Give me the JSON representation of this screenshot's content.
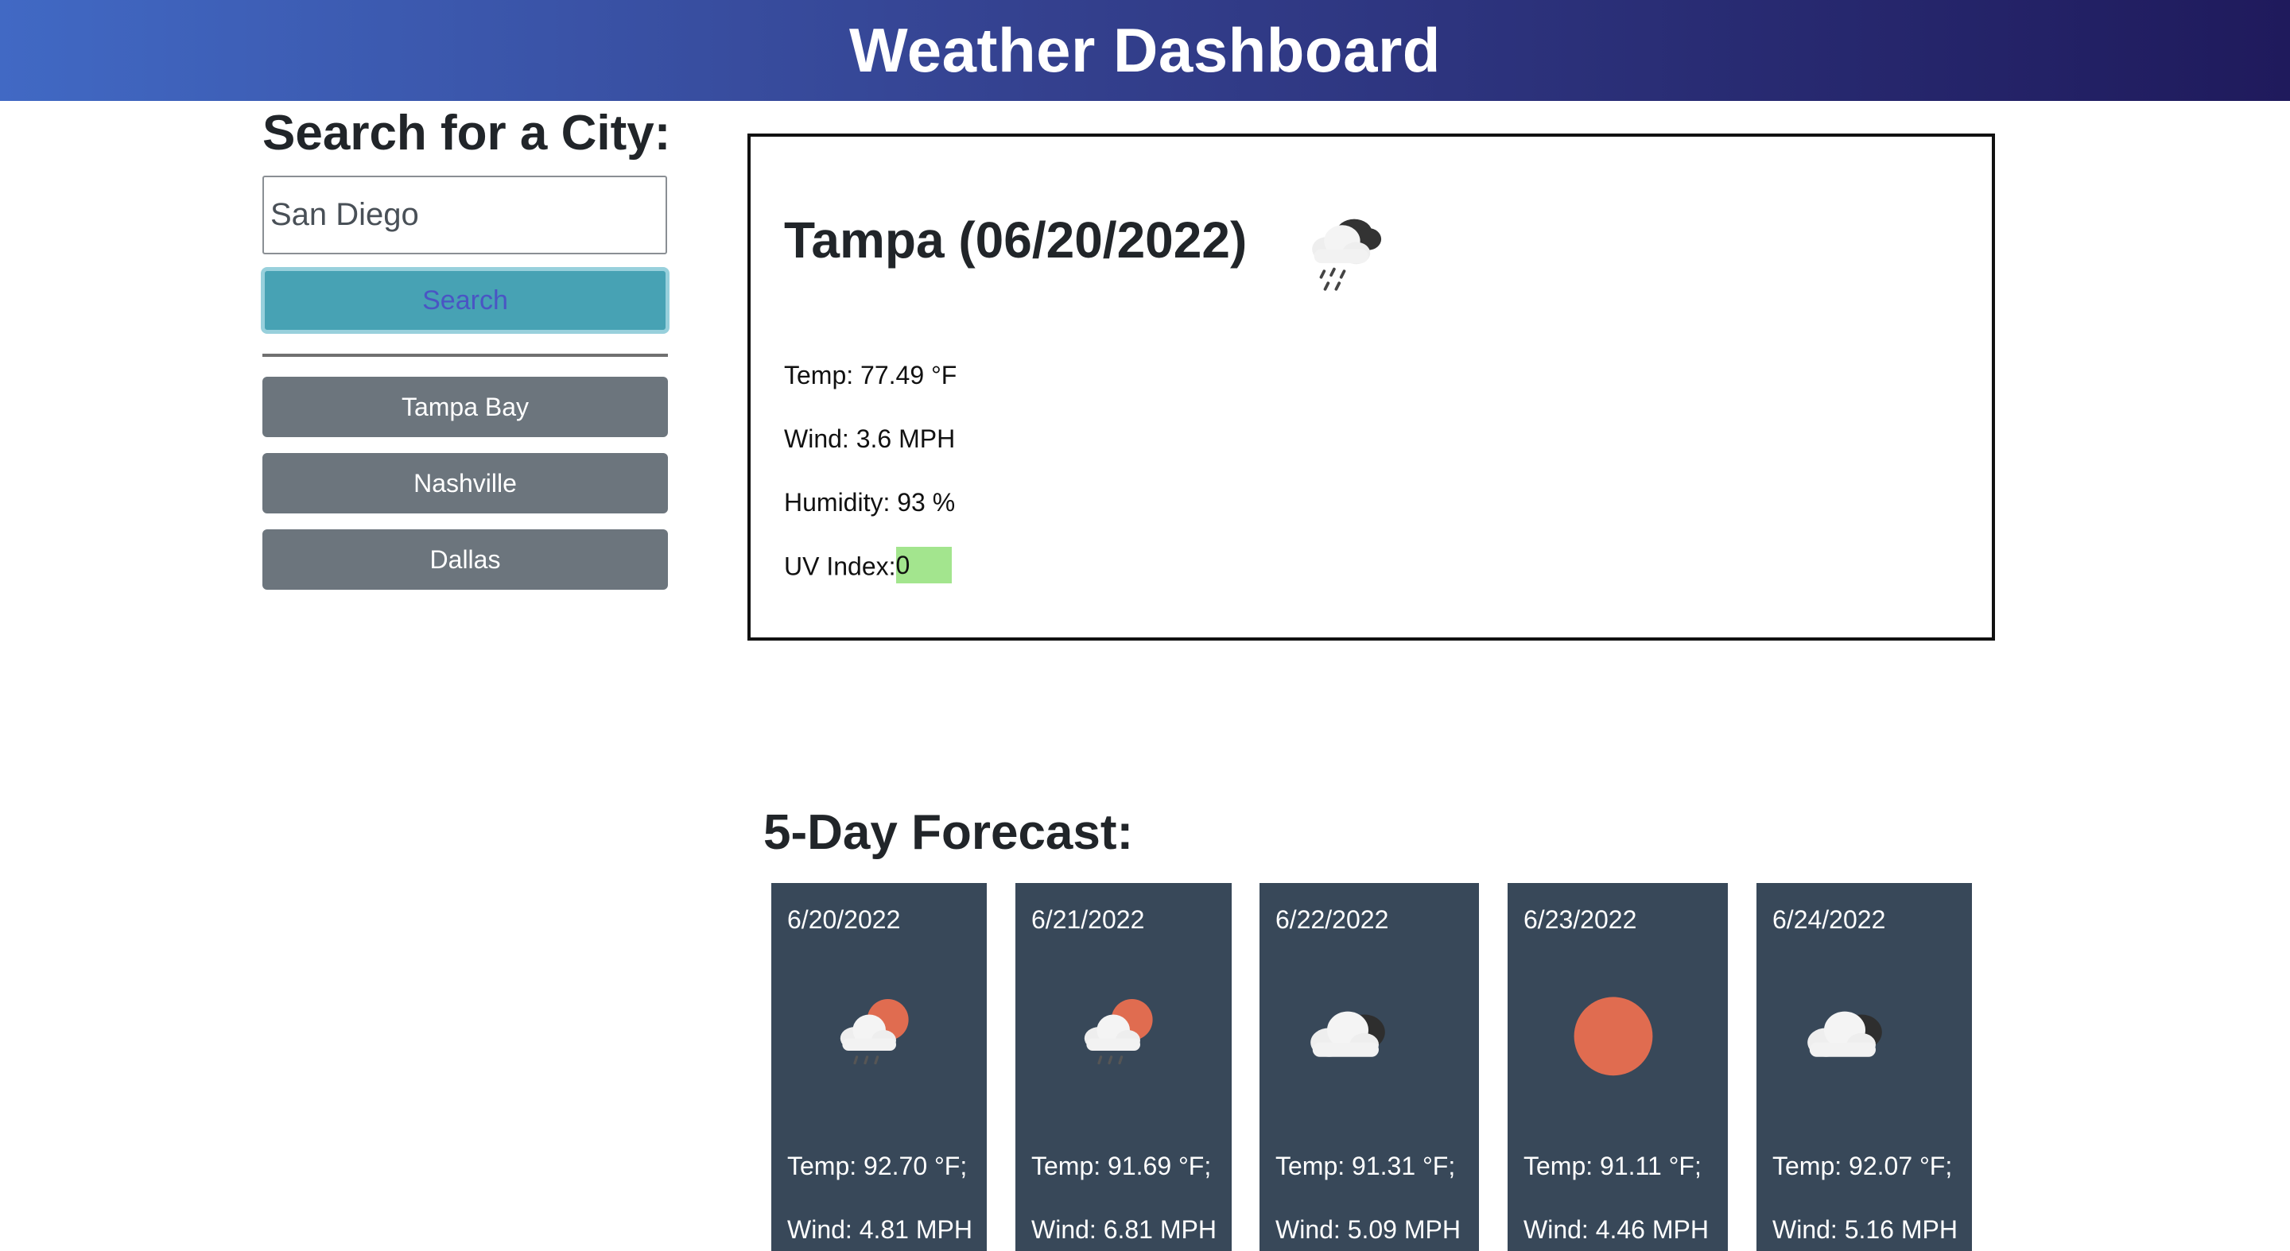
{
  "header": {
    "title": "Weather Dashboard"
  },
  "search": {
    "title": "Search for a City:",
    "input_value": "San Diego",
    "button_label": "Search"
  },
  "history": [
    "Tampa Bay",
    "Nashville",
    "Dallas"
  ],
  "current": {
    "title": "Tampa (06/20/2022)",
    "icon": "rain-cloud-icon",
    "temp": "Temp: 77.49 °F",
    "wind": "Wind: 3.6 MPH",
    "humidity": "Humidity: 93 %",
    "uv_label": "UV Index:",
    "uv_value": "0",
    "uv_color": "#a3e58e"
  },
  "forecast": {
    "title": "5-Day Forecast:",
    "days": [
      {
        "date": "6/20/2022",
        "icon": "sun-cloud-rain-icon",
        "temp": "Temp: 92.70 °F;",
        "wind": "Wind: 4.81 MPH"
      },
      {
        "date": "6/21/2022",
        "icon": "sun-cloud-rain-icon",
        "temp": "Temp: 91.69 °F;",
        "wind": "Wind: 6.81 MPH"
      },
      {
        "date": "6/22/2022",
        "icon": "cloudy-icon",
        "temp": "Temp: 91.31 °F;",
        "wind": "Wind: 5.09 MPH"
      },
      {
        "date": "6/23/2022",
        "icon": "sun-icon",
        "temp": "Temp: 91.11 °F;",
        "wind": "Wind: 4.46 MPH"
      },
      {
        "date": "6/24/2022",
        "icon": "cloudy-icon",
        "temp": "Temp: 92.07 °F;",
        "wind": "Wind: 5.16 MPH"
      }
    ]
  },
  "colors": {
    "header_gradient": [
      "#4169c4",
      "#1f1a5c"
    ],
    "search_button": "#47a2b4",
    "history_button": "#6c757d",
    "forecast_card": "#384859",
    "sun": "#e06c50"
  }
}
